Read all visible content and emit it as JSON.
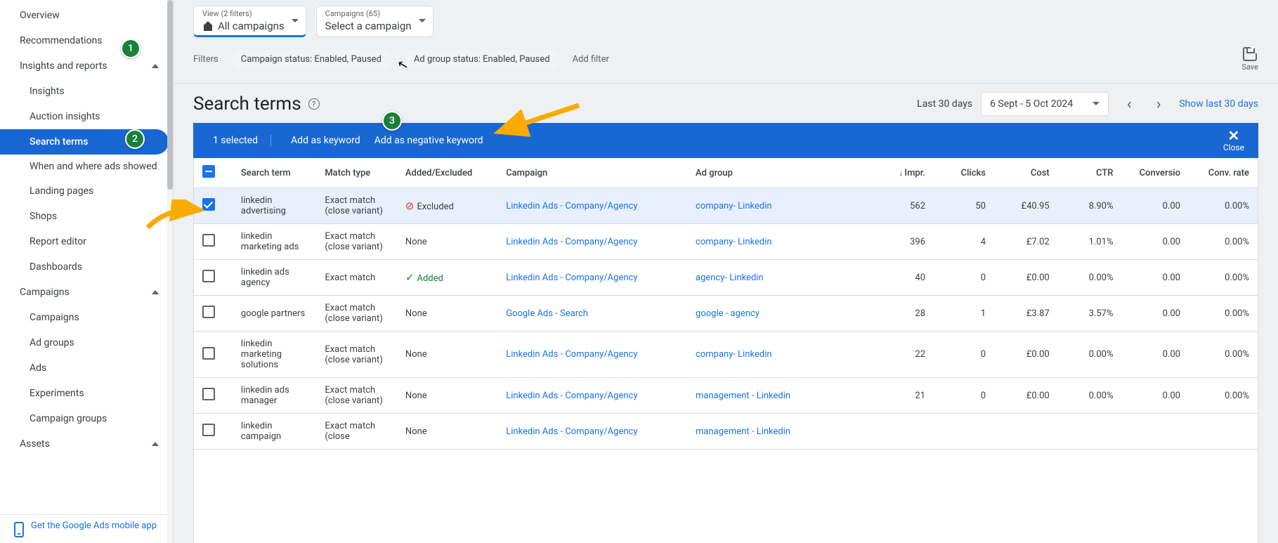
{
  "sidebar": {
    "overview": "Overview",
    "recommendations": "Recommendations",
    "insights_section": "Insights and reports",
    "insights": "Insights",
    "auction": "Auction insights",
    "search_terms": "Search terms",
    "when_where": "When and where ads showed",
    "landing": "Landing pages",
    "shops": "Shops",
    "report_editor": "Report editor",
    "dashboards": "Dashboards",
    "campaigns_section": "Campaigns",
    "campaigns": "Campaigns",
    "ad_groups": "Ad groups",
    "ads": "Ads",
    "experiments": "Experiments",
    "campaign_groups": "Campaign groups",
    "assets_section": "Assets",
    "mobile_app": "Get the Google Ads mobile app"
  },
  "top": {
    "view_label": "View (2 filters)",
    "view_value": "All campaigns",
    "camp_label": "Campaigns (65)",
    "camp_value": "Select a campaign",
    "filters_label": "Filters",
    "chip1": "Campaign status: Enabled, Paused",
    "chip2": "Ad group status: Enabled, Paused",
    "add_filter": "Add filter",
    "save": "Save"
  },
  "title": {
    "page_title": "Search terms",
    "range_label": "Last 30 days",
    "date_range": "6 Sept - 5 Oct 2024",
    "show_last": "Show last 30 days"
  },
  "selbar": {
    "count": "1 selected",
    "add_keyword": "Add as keyword",
    "add_neg": "Add as negative keyword",
    "close": "Close"
  },
  "headers": {
    "term": "Search term",
    "match": "Match type",
    "added": "Added/Excluded",
    "campaign": "Campaign",
    "adgroup": "Ad group",
    "impr": "Impr.",
    "clicks": "Clicks",
    "cost": "Cost",
    "ctr": "CTR",
    "conversions": "Conversio",
    "conv_rate": "Conv. rate"
  },
  "rows": [
    {
      "checked": true,
      "term": "linkedin advertising",
      "match": "Exact match (close variant)",
      "status": "excluded",
      "status_label": "Excluded",
      "campaign": "Linkedin Ads - Company/Agency",
      "adgroup": "company- Linkedin",
      "impr": "562",
      "clicks": "50",
      "cost": "£40.95",
      "ctr": "8.90%",
      "conv": "0.00",
      "rate": "0.00%"
    },
    {
      "checked": false,
      "term": "linkedin marketing ads",
      "match": "Exact match (close variant)",
      "status": "none",
      "status_label": "None",
      "campaign": "Linkedin Ads - Company/Agency",
      "adgroup": "company- Linkedin",
      "impr": "396",
      "clicks": "4",
      "cost": "£7.02",
      "ctr": "1.01%",
      "conv": "0.00",
      "rate": "0.00%"
    },
    {
      "checked": false,
      "term": "linkedin ads agency",
      "match": "Exact match",
      "status": "added",
      "status_label": "Added",
      "campaign": "Linkedin Ads - Company/Agency",
      "adgroup": "agency- Linkedin",
      "impr": "40",
      "clicks": "0",
      "cost": "£0.00",
      "ctr": "0.00%",
      "conv": "0.00",
      "rate": "0.00%"
    },
    {
      "checked": false,
      "term": "google partners",
      "match": "Exact match (close variant)",
      "status": "none",
      "status_label": "None",
      "campaign": "Google Ads - Search",
      "adgroup": "google - agency",
      "impr": "28",
      "clicks": "1",
      "cost": "£3.87",
      "ctr": "3.57%",
      "conv": "0.00",
      "rate": "0.00%"
    },
    {
      "checked": false,
      "term": "linkedin marketing solutions",
      "match": "Exact match (close variant)",
      "status": "none",
      "status_label": "None",
      "campaign": "Linkedin Ads - Company/Agency",
      "adgroup": "company- Linkedin",
      "impr": "22",
      "clicks": "0",
      "cost": "£0.00",
      "ctr": "0.00%",
      "conv": "0.00",
      "rate": "0.00%"
    },
    {
      "checked": false,
      "term": "linkedin ads manager",
      "match": "Exact match (close variant)",
      "status": "none",
      "status_label": "None",
      "campaign": "Linkedin Ads - Company/Agency",
      "adgroup": "management - Linkedin",
      "impr": "21",
      "clicks": "0",
      "cost": "£0.00",
      "ctr": "0.00%",
      "conv": "0.00",
      "rate": "0.00%"
    },
    {
      "checked": false,
      "term": "linkedin campaign",
      "match": "Exact match (close",
      "status": "none",
      "status_label": "None",
      "campaign": "Linkedin Ads - Company/Agency",
      "adgroup": "management - Linkedin",
      "impr": "",
      "clicks": "",
      "cost": "",
      "ctr": "",
      "conv": "",
      "rate": ""
    }
  ],
  "badges": {
    "b1": "1",
    "b2": "2",
    "b3": "3"
  }
}
